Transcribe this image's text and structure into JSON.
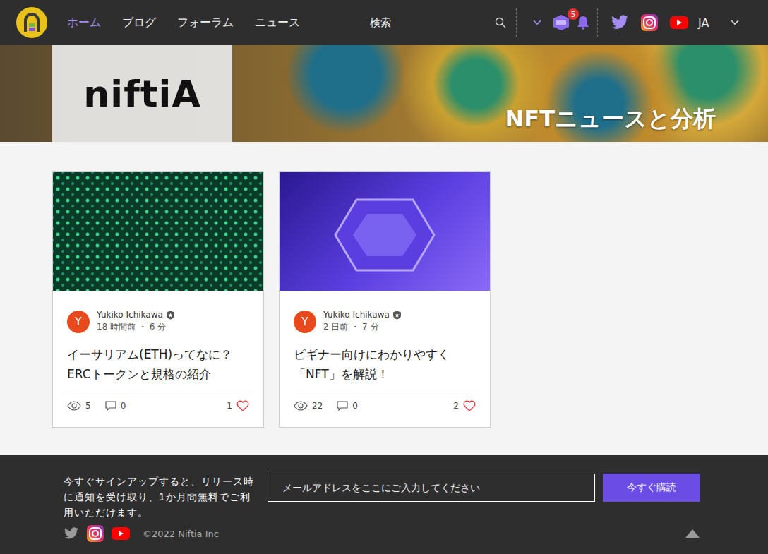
{
  "nav": {
    "items": [
      {
        "label": "ホーム",
        "selected": true
      },
      {
        "label": "ブログ",
        "selected": false
      },
      {
        "label": "フォーラム",
        "selected": false
      },
      {
        "label": "ニュース",
        "selected": false
      }
    ],
    "search": {
      "label": "検索"
    },
    "notifications": {
      "count": "5"
    },
    "language": "JA"
  },
  "banner": {
    "logo_text": "niftiA",
    "title": "NFTニュースと分析"
  },
  "posts": [
    {
      "kind": "matrix",
      "avatar": "Y",
      "author": "Yukiko Ichikawa",
      "meta": "18 時間前 ・ 6 分",
      "title": "イーサリアム(ETH)ってなに？ERCトークンと規格の紹介",
      "views": "5",
      "comments": "0",
      "likes": "1"
    },
    {
      "kind": "nft",
      "avatar": "Y",
      "author": "Yukiko Ichikawa",
      "meta": "2 日前 ・ 7 分",
      "title": "ビギナー向けにわかりやすく「NFT」を解説！",
      "views": "22",
      "comments": "0",
      "likes": "2"
    }
  ],
  "footer": {
    "signup_text": "今すぐサインアップすると、リリース時に通知を受け取り、1か月間無料でご利用いただけます。",
    "email_placeholder": "メールアドレスをここにご入力してください",
    "subscribe": "今すぐ購読",
    "copyright": "©2022 Niftia Inc"
  }
}
